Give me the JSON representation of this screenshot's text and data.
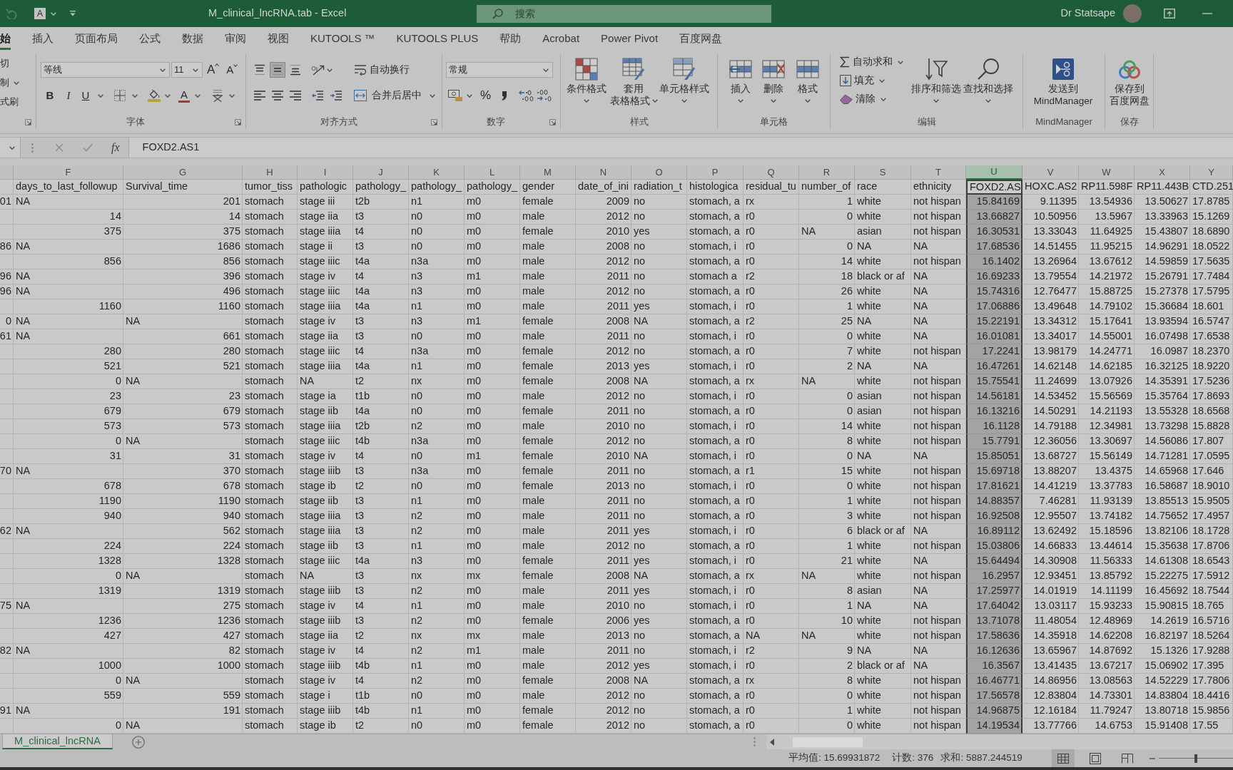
{
  "window": {
    "quick_access": "A",
    "title": "M_clinical_lncRNA.tab - Excel",
    "search": {
      "placeholder": "搜索"
    },
    "user": "Dr Statsape"
  },
  "ribbon_tabs": [
    {
      "label": "始",
      "selected": true
    },
    {
      "label": "插入",
      "selected": false
    },
    {
      "label": "页面布局",
      "selected": false
    },
    {
      "label": "公式",
      "selected": false
    },
    {
      "label": "数据",
      "selected": false
    },
    {
      "label": "审阅",
      "selected": false
    },
    {
      "label": "视图",
      "selected": false
    },
    {
      "label": "KUTOOLS ™",
      "selected": false
    },
    {
      "label": "KUTOOLS PLUS",
      "selected": false
    },
    {
      "label": "帮助",
      "selected": false
    },
    {
      "label": "Acrobat",
      "selected": false
    },
    {
      "label": "Power Pivot",
      "selected": false
    },
    {
      "label": "百度网盘",
      "selected": false
    }
  ],
  "ribbon": {
    "clipboard": {
      "items": [
        "切",
        "制",
        "式刷"
      ]
    },
    "font": {
      "name": "等线",
      "size": "11",
      "grow": "A",
      "shrink": "A",
      "bold": "B",
      "italic": "I",
      "underline": "U",
      "font_color": "A",
      "label": "字体"
    },
    "alignment": {
      "vertical": [
        {
          "kind": "top",
          "selected": false
        },
        {
          "kind": "middle",
          "selected": true
        },
        {
          "kind": "bottom",
          "selected": false
        }
      ],
      "horizontal": [
        {
          "kind": "left",
          "selected": false
        },
        {
          "kind": "center",
          "selected": false
        },
        {
          "kind": "right",
          "selected": false
        }
      ],
      "wrap_text": "自动换行",
      "merge_center": "合并后居中",
      "label": "对齐方式"
    },
    "number": {
      "format": "常规",
      "percent": "%",
      "label": "数字"
    },
    "styles": {
      "buttons": [
        {
          "kind": "conditional",
          "lines": [
            "条件格式"
          ]
        },
        {
          "kind": "table",
          "lines": [
            "套用",
            "表格格式"
          ]
        },
        {
          "kind": "cell_styles",
          "lines": [
            "单元格样式"
          ]
        }
      ],
      "label": "样式"
    },
    "cells": {
      "buttons": [
        {
          "kind": "insert",
          "lines": [
            "插入"
          ]
        },
        {
          "kind": "delete",
          "lines": [
            "删除"
          ]
        },
        {
          "kind": "format",
          "lines": [
            "格式"
          ]
        }
      ],
      "label": "单元格"
    },
    "editing": {
      "commands": [
        {
          "kind": "autosum",
          "label": "自动求和"
        },
        {
          "kind": "fill",
          "label": "填充"
        },
        {
          "kind": "clear",
          "label": "清除"
        }
      ],
      "buttons": [
        {
          "kind": "sort",
          "lines": [
            "排序和筛选"
          ]
        },
        {
          "kind": "find",
          "lines": [
            "查找和选择"
          ]
        }
      ],
      "label": "编辑"
    },
    "mindmanager": {
      "buttons": [
        {
          "kind": "mindmanager",
          "lines": [
            "发送到",
            "MindManager"
          ]
        }
      ],
      "label": "MindManager"
    },
    "save": {
      "buttons": [
        {
          "kind": "baidu",
          "lines": [
            "保存到",
            "百度网盘"
          ]
        }
      ],
      "label": "保存"
    }
  },
  "formula_bar": {
    "fx": "fx",
    "formula": "FOXD2.AS1"
  },
  "sheet": {
    "columns": [
      {
        "selected": false
      },
      {
        "letter": "F",
        "selected": false
      },
      {
        "letter": "G",
        "selected": false
      },
      {
        "letter": "H",
        "selected": false
      },
      {
        "letter": "I",
        "selected": false
      },
      {
        "letter": "J",
        "selected": false
      },
      {
        "letter": "K",
        "selected": false
      },
      {
        "letter": "L",
        "selected": false
      },
      {
        "letter": "M",
        "selected": false
      },
      {
        "letter": "N",
        "selected": false
      },
      {
        "letter": "O",
        "selected": false
      },
      {
        "letter": "P",
        "selected": false
      },
      {
        "letter": "Q",
        "selected": false
      },
      {
        "letter": "R",
        "selected": false
      },
      {
        "letter": "S",
        "selected": false
      },
      {
        "letter": "T",
        "selected": false
      },
      {
        "letter": "U",
        "selected": true
      },
      {
        "letter": "V",
        "selected": false
      },
      {
        "letter": "W",
        "selected": false
      },
      {
        "letter": "X",
        "selected": false
      },
      {
        "letter": "Y",
        "selected": false
      }
    ],
    "rows": [
      [
        null,
        "days_to_last_followup",
        "Survival_time",
        "tumor_tiss",
        "pathologic",
        "pathology_",
        "pathology_",
        "pathology_",
        "gender",
        "date_of_ini",
        "radiation_t",
        "histologica",
        "residual_tu",
        "number_of",
        "race",
        "ethnicity",
        "FOXD2.AS",
        "HOXC.AS2",
        "RP11.598F",
        "RP11.443B",
        "CTD.251"
      ],
      [
        "01",
        "NA",
        "201",
        "stomach",
        "stage iii",
        "t2b",
        "n1",
        "m0",
        "female",
        "2009",
        "no",
        "stomach, a",
        "rx",
        "1",
        "white",
        "not hispan",
        "15.84169",
        "9.11395",
        "13.54936",
        "13.50627",
        "17.8785"
      ],
      [
        null,
        "14",
        "14",
        "stomach",
        "stage iia",
        "t3",
        "n0",
        "m0",
        "male",
        "2012",
        "no",
        "stomach, a",
        "r0",
        "0",
        "white",
        "not hispan",
        "13.66827",
        "10.50956",
        "13.5967",
        "13.33963",
        "15.1269"
      ],
      [
        null,
        "375",
        "375",
        "stomach",
        "stage iiia",
        "t4",
        "n0",
        "m0",
        "female",
        "2010",
        "yes",
        "stomach, a",
        "r0",
        "NA",
        "asian",
        "not hispan",
        "16.30531",
        "13.33043",
        "11.64925",
        "15.43807",
        "18.6890"
      ],
      [
        "86",
        "NA",
        "1686",
        "stomach",
        "stage ii",
        "t3",
        "n0",
        "m0",
        "male",
        "2008",
        "no",
        "stomach, i",
        "r0",
        "0",
        "NA",
        "NA",
        "17.68536",
        "14.51455",
        "11.95215",
        "14.96291",
        "18.0522"
      ],
      [
        null,
        "856",
        "856",
        "stomach",
        "stage iiic",
        "t4a",
        "n3a",
        "m0",
        "male",
        "2012",
        "no",
        "stomach, a",
        "r0",
        "14",
        "white",
        "not hispan",
        "16.1402",
        "13.26964",
        "13.67612",
        "14.59859",
        "17.5635"
      ],
      [
        "96",
        "NA",
        "396",
        "stomach",
        "stage iv",
        "t4",
        "n3",
        "m1",
        "male",
        "2011",
        "no",
        "stomach a",
        "r2",
        "18",
        "black or af",
        "NA",
        "16.69233",
        "13.79554",
        "14.21972",
        "15.26791",
        "17.7484"
      ],
      [
        "96",
        "NA",
        "496",
        "stomach",
        "stage iiic",
        "t4a",
        "n3",
        "m0",
        "male",
        "2012",
        "no",
        "stomach, a",
        "r0",
        "26",
        "white",
        "NA",
        "15.74316",
        "12.76477",
        "15.88725",
        "15.27378",
        "17.5795"
      ],
      [
        null,
        "1160",
        "1160",
        "stomach",
        "stage iiia",
        "t4a",
        "n1",
        "m0",
        "male",
        "2011",
        "yes",
        "stomach, i",
        "r0",
        "1",
        "white",
        "NA",
        "17.06886",
        "13.49648",
        "14.79102",
        "15.36684",
        "18.601"
      ],
      [
        "0",
        "NA",
        "NA",
        "stomach",
        "stage iv",
        "t3",
        "n3",
        "m1",
        "female",
        "2008",
        "NA",
        "stomach, a",
        "r2",
        "25",
        "NA",
        "NA",
        "15.22191",
        "13.34312",
        "15.17641",
        "13.93594",
        "16.5747"
      ],
      [
        "61",
        "NA",
        "661",
        "stomach",
        "stage iia",
        "t3",
        "n0",
        "m0",
        "male",
        "2011",
        "no",
        "stomach, i",
        "r0",
        "0",
        "white",
        "NA",
        "16.01081",
        "13.34017",
        "14.55001",
        "16.07498",
        "17.6538"
      ],
      [
        null,
        "280",
        "280",
        "stomach",
        "stage iiic",
        "t4",
        "n3a",
        "m0",
        "female",
        "2012",
        "no",
        "stomach, a",
        "r0",
        "7",
        "white",
        "not hispan",
        "17.2241",
        "13.98179",
        "14.24771",
        "16.0987",
        "18.2370"
      ],
      [
        null,
        "521",
        "521",
        "stomach",
        "stage iiia",
        "t4a",
        "n1",
        "m0",
        "female",
        "2013",
        "yes",
        "stomach, i",
        "r0",
        "2",
        "NA",
        "NA",
        "16.47261",
        "14.62148",
        "14.62185",
        "16.32125",
        "18.9220"
      ],
      [
        null,
        "0",
        "NA",
        "stomach",
        "NA",
        "t2",
        "nx",
        "m0",
        "female",
        "2008",
        "NA",
        "stomach, a",
        "rx",
        "NA",
        "white",
        "not hispan",
        "15.75541",
        "11.24699",
        "13.07926",
        "14.35391",
        "17.5236"
      ],
      [
        null,
        "23",
        "23",
        "stomach",
        "stage ia",
        "t1b",
        "n0",
        "m0",
        "male",
        "2012",
        "no",
        "stomach, i",
        "r0",
        "0",
        "asian",
        "not hispan",
        "14.56181",
        "14.53452",
        "15.56569",
        "15.35764",
        "17.8693"
      ],
      [
        null,
        "679",
        "679",
        "stomach",
        "stage iib",
        "t4a",
        "n0",
        "m0",
        "female",
        "2011",
        "no",
        "stomach, a",
        "r0",
        "0",
        "asian",
        "not hispan",
        "16.13216",
        "14.50291",
        "14.21193",
        "13.55328",
        "18.6568"
      ],
      [
        null,
        "573",
        "573",
        "stomach",
        "stage iiia",
        "t2b",
        "n2",
        "m0",
        "male",
        "2010",
        "no",
        "stomach, i",
        "r0",
        "14",
        "white",
        "not hispan",
        "16.1128",
        "14.79188",
        "12.34981",
        "13.73298",
        "15.8828"
      ],
      [
        null,
        "0",
        "NA",
        "stomach",
        "stage iiic",
        "t4b",
        "n3a",
        "m0",
        "female",
        "2012",
        "no",
        "stomach, a",
        "r0",
        "8",
        "white",
        "not hispan",
        "15.7791",
        "12.36056",
        "13.30697",
        "14.56086",
        "17.807"
      ],
      [
        null,
        "31",
        "31",
        "stomach",
        "stage iv",
        "t4",
        "n0",
        "m1",
        "female",
        "2010",
        "NA",
        "stomach, i",
        "r0",
        "0",
        "NA",
        "NA",
        "15.85051",
        "13.68727",
        "15.56149",
        "14.71281",
        "17.0595"
      ],
      [
        "70",
        "NA",
        "370",
        "stomach",
        "stage iiib",
        "t3",
        "n3a",
        "m0",
        "female",
        "2011",
        "no",
        "stomach, a",
        "r1",
        "15",
        "white",
        "not hispan",
        "15.69718",
        "13.88207",
        "13.4375",
        "14.65968",
        "17.646"
      ],
      [
        null,
        "678",
        "678",
        "stomach",
        "stage ib",
        "t2",
        "n0",
        "m0",
        "female",
        "2013",
        "no",
        "stomach, i",
        "r0",
        "0",
        "white",
        "not hispan",
        "17.81621",
        "14.41219",
        "13.37783",
        "16.58687",
        "18.9010"
      ],
      [
        null,
        "1190",
        "1190",
        "stomach",
        "stage iib",
        "t3",
        "n1",
        "m0",
        "male",
        "2011",
        "no",
        "stomach, a",
        "r0",
        "1",
        "white",
        "not hispan",
        "14.88357",
        "7.46281",
        "11.93139",
        "13.85513",
        "15.9505"
      ],
      [
        null,
        "940",
        "940",
        "stomach",
        "stage iiia",
        "t3",
        "n2",
        "m0",
        "male",
        "2011",
        "no",
        "stomach, a",
        "r0",
        "3",
        "white",
        "not hispan",
        "16.92508",
        "12.95507",
        "13.74182",
        "14.75652",
        "17.4957"
      ],
      [
        "62",
        "NA",
        "562",
        "stomach",
        "stage iiia",
        "t3",
        "n2",
        "m0",
        "male",
        "2011",
        "yes",
        "stomach, i",
        "r0",
        "6",
        "black or af",
        "NA",
        "16.89112",
        "13.62492",
        "15.18596",
        "13.82106",
        "18.1728"
      ],
      [
        null,
        "224",
        "224",
        "stomach",
        "stage iib",
        "t3",
        "n1",
        "m0",
        "male",
        "2012",
        "no",
        "stomach, a",
        "r0",
        "1",
        "white",
        "not hispan",
        "15.03806",
        "14.66833",
        "13.44614",
        "15.35638",
        "17.8706"
      ],
      [
        null,
        "1328",
        "1328",
        "stomach",
        "stage iiic",
        "t4a",
        "n3",
        "m0",
        "female",
        "2011",
        "yes",
        "stomach, i",
        "r0",
        "21",
        "white",
        "NA",
        "15.64494",
        "14.30908",
        "11.56333",
        "14.61308",
        "18.6543"
      ],
      [
        null,
        "0",
        "NA",
        "stomach",
        "NA",
        "t3",
        "nx",
        "mx",
        "female",
        "2008",
        "NA",
        "stomach, a",
        "rx",
        "NA",
        "white",
        "not hispan",
        "16.2957",
        "12.93451",
        "13.85792",
        "15.22275",
        "17.5912"
      ],
      [
        null,
        "1319",
        "1319",
        "stomach",
        "stage iiib",
        "t3",
        "n2",
        "m0",
        "male",
        "2011",
        "yes",
        "stomach, i",
        "r0",
        "8",
        "asian",
        "NA",
        "17.25977",
        "14.01919",
        "14.11199",
        "16.45692",
        "18.7544"
      ],
      [
        "75",
        "NA",
        "275",
        "stomach",
        "stage iv",
        "t4",
        "n1",
        "m0",
        "male",
        "2010",
        "no",
        "stomach, i",
        "r0",
        "1",
        "NA",
        "NA",
        "17.64042",
        "13.03117",
        "15.93233",
        "15.90815",
        "18.765"
      ],
      [
        null,
        "1236",
        "1236",
        "stomach",
        "stage iiib",
        "t3",
        "n2",
        "m0",
        "female",
        "2006",
        "yes",
        "stomach, a",
        "r0",
        "10",
        "white",
        "not hispan",
        "13.71078",
        "11.48054",
        "12.48969",
        "14.2619",
        "16.5716"
      ],
      [
        null,
        "427",
        "427",
        "stomach",
        "stage iia",
        "t2",
        "nx",
        "mx",
        "male",
        "2013",
        "no",
        "stomach, a",
        "NA",
        "NA",
        "white",
        "not hispan",
        "17.58636",
        "14.35918",
        "14.62208",
        "16.82197",
        "18.5264"
      ],
      [
        "82",
        "NA",
        "82",
        "stomach",
        "stage iv",
        "t4",
        "n2",
        "m1",
        "male",
        "2011",
        "no",
        "stomach, i",
        "r2",
        "9",
        "NA",
        "NA",
        "16.12636",
        "13.65967",
        "14.87692",
        "15.1326",
        "17.9288"
      ],
      [
        null,
        "1000",
        "1000",
        "stomach",
        "stage iiib",
        "t4b",
        "n1",
        "m0",
        "male",
        "2012",
        "yes",
        "stomach, i",
        "r0",
        "2",
        "black or af",
        "NA",
        "16.3567",
        "13.41435",
        "13.67217",
        "15.06902",
        "17.395"
      ],
      [
        null,
        "0",
        "NA",
        "stomach",
        "stage iv",
        "t4",
        "n2",
        "m0",
        "female",
        "2008",
        "NA",
        "stomach, a",
        "rx",
        "8",
        "white",
        "not hispan",
        "16.46771",
        "14.86956",
        "13.08563",
        "14.52229",
        "17.7806"
      ],
      [
        null,
        "559",
        "559",
        "stomach",
        "stage i",
        "t1b",
        "n0",
        "m0",
        "male",
        "2012",
        "no",
        "stomach, a",
        "r0",
        "0",
        "white",
        "not hispan",
        "17.56578",
        "12.83804",
        "14.73301",
        "14.83804",
        "18.4416"
      ],
      [
        "91",
        "NA",
        "191",
        "stomach",
        "stage iiib",
        "t4b",
        "n1",
        "m0",
        "female",
        "2012",
        "no",
        "stomach, a",
        "r0",
        "1",
        "white",
        "not hispan",
        "14.96875",
        "12.16184",
        "11.79247",
        "13.80718",
        "15.9856"
      ],
      [
        null,
        "0",
        "NA",
        "stomach",
        "stage ib",
        "t2",
        "n0",
        "m0",
        "female",
        "2012",
        "no",
        "stomach, a",
        "r0",
        "0",
        "white",
        "not hispan",
        "14.19534",
        "13.77766",
        "14.6753",
        "15.91408",
        "17.55"
      ]
    ]
  },
  "sheet_tabs": [
    {
      "label": "M_clinical_lncRNA",
      "selected": true
    }
  ],
  "status_bar": {
    "average": "平均值: 15.69931872",
    "count": "计数: 376",
    "sum": "求和: 5887.244519",
    "views": [
      {
        "kind": "normal",
        "selected": true
      },
      {
        "kind": "page_layout",
        "selected": false
      },
      {
        "kind": "page_break",
        "selected": false
      }
    ],
    "zoom": {
      "level": 0.5
    }
  }
}
